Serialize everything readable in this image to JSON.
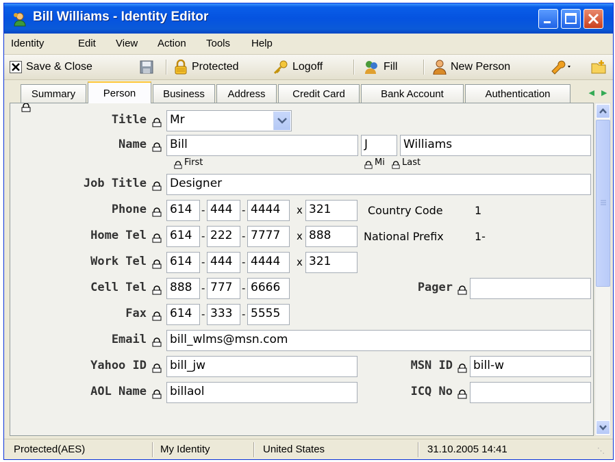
{
  "window": {
    "title": "Bill Williams - Identity Editor",
    "title_icon": "person-icon"
  },
  "menu": [
    "Identity",
    "Edit",
    "View",
    "Action",
    "Tools",
    "Help"
  ],
  "toolbar": {
    "save_close": "Save & Close",
    "protected": "Protected",
    "logoff": "Logoff",
    "fill": "Fill",
    "new_person": "New Person"
  },
  "tabs": [
    "Summary",
    "Person",
    "Business",
    "Address",
    "Credit Card",
    "Bank Account",
    "Authentication"
  ],
  "active_tab": "Person",
  "form": {
    "title_label": "Title",
    "title_value": "Mr",
    "name_label": "Name",
    "first": "Bill",
    "mi": "J",
    "last": "Williams",
    "first_caption": "First",
    "mi_caption": "Mi",
    "last_caption": "Last",
    "job_title_label": "Job Title",
    "job_title": "Designer",
    "phone_label": "Phone",
    "phone": [
      "614",
      "444",
      "4444"
    ],
    "phone_ext": "321",
    "country_code_label": "Country Code",
    "country_code": "1",
    "home_tel_label": "Home Tel",
    "home_tel": [
      "614",
      "222",
      "7777"
    ],
    "home_tel_ext": "888",
    "national_prefix_label": "National Prefix",
    "national_prefix": "1-",
    "work_tel_label": "Work Tel",
    "work_tel": [
      "614",
      "444",
      "4444"
    ],
    "work_tel_ext": "321",
    "cell_tel_label": "Cell Tel",
    "cell_tel": [
      "888",
      "777",
      "6666"
    ],
    "pager_label": "Pager",
    "pager": "",
    "fax_label": "Fax",
    "fax": [
      "614",
      "333",
      "5555"
    ],
    "email_label": "Email",
    "email": "bill_wlms@msn.com",
    "yahoo_label": "Yahoo ID",
    "yahoo": "bill_jw",
    "msn_label": "MSN ID",
    "msn": "bill-w",
    "aol_label": "AOL Name",
    "aol": "billaol",
    "icq_label": "ICQ No",
    "icq": "",
    "ext_marker": "x"
  },
  "status": {
    "encryption": "Protected(AES)",
    "identity": "My Identity",
    "country": "United States",
    "datetime": "31.10.2005 14:41"
  },
  "colors": {
    "titlebar": "#0553e0",
    "accent_tab": "#ffc83c",
    "window_bg": "#ece9d8"
  }
}
